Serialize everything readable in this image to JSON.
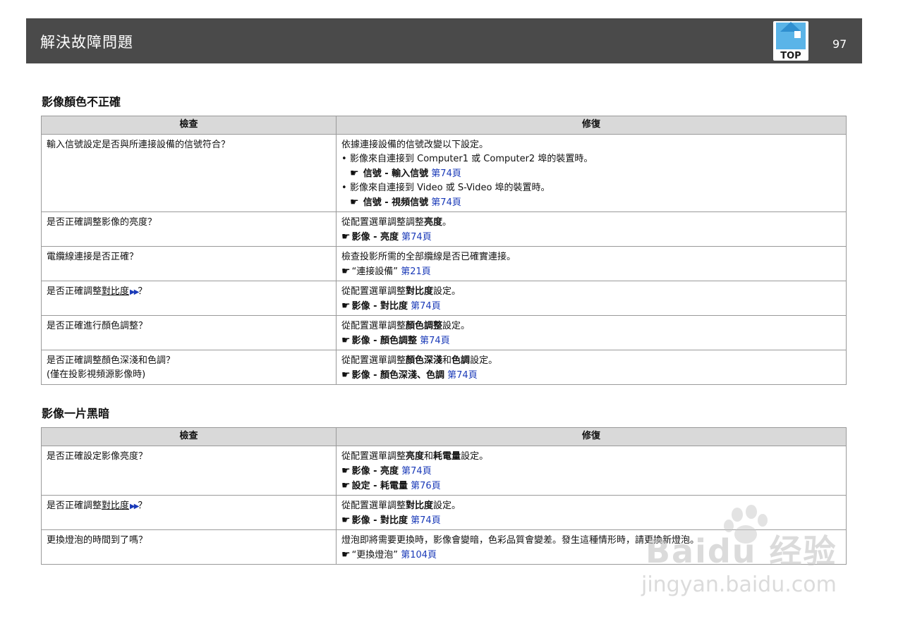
{
  "header": {
    "title": "解決故障問題",
    "top_label": "TOP",
    "page_number": "97"
  },
  "section1": {
    "title": "影像顏色不正確",
    "col_check": "檢查",
    "col_fix": "修復",
    "rows": [
      {
        "check": "輸入信號設定是否與所連接設備的信號符合？",
        "fix_intro": "依據連接設備的信號改變以下設定。",
        "bullet1": "影像來自連接到 Computer1 或 Computer2 埠的裝置時。",
        "bullet1_ref": "信號 - 輸入信號",
        "bullet1_link": "第74頁",
        "bullet2": "影像來自連接到 Video 或 S-Video 埠的裝置時。",
        "bullet2_ref": "信號 - 視頻信號",
        "bullet2_link": "第74頁"
      },
      {
        "check": "是否正確調整影像的亮度？",
        "fix_pre": "從配置選單調整調整",
        "fix_bold": "亮度",
        "fix_post": "。",
        "ref": "影像 - 亮度",
        "link": "第74頁"
      },
      {
        "check": "電纜線連接是否正確？",
        "fix": "檢查投影所需的全部纜線是否已確實連接。",
        "ref": "“連接設備”",
        "link": "第21頁"
      },
      {
        "check_pre": "是否正確調整",
        "check_term": "對比度",
        "check_post": "？",
        "fix_pre": "從配置選單調整",
        "fix_bold": "對比度",
        "fix_post": "設定。",
        "ref": "影像 - 對比度",
        "link": "第74頁"
      },
      {
        "check": "是否正確進行顏色調整？",
        "fix_pre": "從配置選單調整",
        "fix_bold": "顏色調整",
        "fix_post": "設定。",
        "ref": "影像 - 顏色調整",
        "link": "第74頁"
      },
      {
        "check": "是否正確調整顏色深淺和色調？",
        "check_note": "(僅在投影視頻源影像時)",
        "fix_pre": "從配置選單調整",
        "fix_bold1": "顏色深淺",
        "fix_mid": "和",
        "fix_bold2": "色調",
        "fix_post": "設定。",
        "ref": "影像 - 顏色深淺、色調",
        "link": "第74頁"
      }
    ]
  },
  "section2": {
    "title": "影像一片黑暗",
    "col_check": "檢查",
    "col_fix": "修復",
    "rows": [
      {
        "check": "是否正確設定影像亮度？",
        "fix_pre": "從配置選單調整",
        "fix_bold1": "亮度",
        "fix_mid": "和",
        "fix_bold2": "耗電量",
        "fix_post": "設定。",
        "ref1": "影像 - 亮度",
        "link1": "第74頁",
        "ref2": "設定 - 耗電量",
        "link2": "第76頁"
      },
      {
        "check_pre": "是否正確調整",
        "check_term": "對比度",
        "check_post": "？",
        "fix_pre": "從配置選單調整",
        "fix_bold": "對比度",
        "fix_post": "設定。",
        "ref": "影像 - 對比度",
        "link": "第74頁"
      },
      {
        "check": "更換燈泡的時間到了嗎？",
        "fix": "燈泡即將需要更換時，影像會變暗，色彩品質會變差。發生這種情形時，請更換新燈泡。",
        "ref": "“更換燈泡”",
        "link": "第104頁"
      }
    ]
  },
  "watermark": {
    "line1": "Baidu 经验",
    "line2": "jingyan.baidu.com"
  },
  "icons": {
    "hand": "pointing-hand-icon",
    "glossary": "double-arrow-icon",
    "top": "home-icon"
  }
}
